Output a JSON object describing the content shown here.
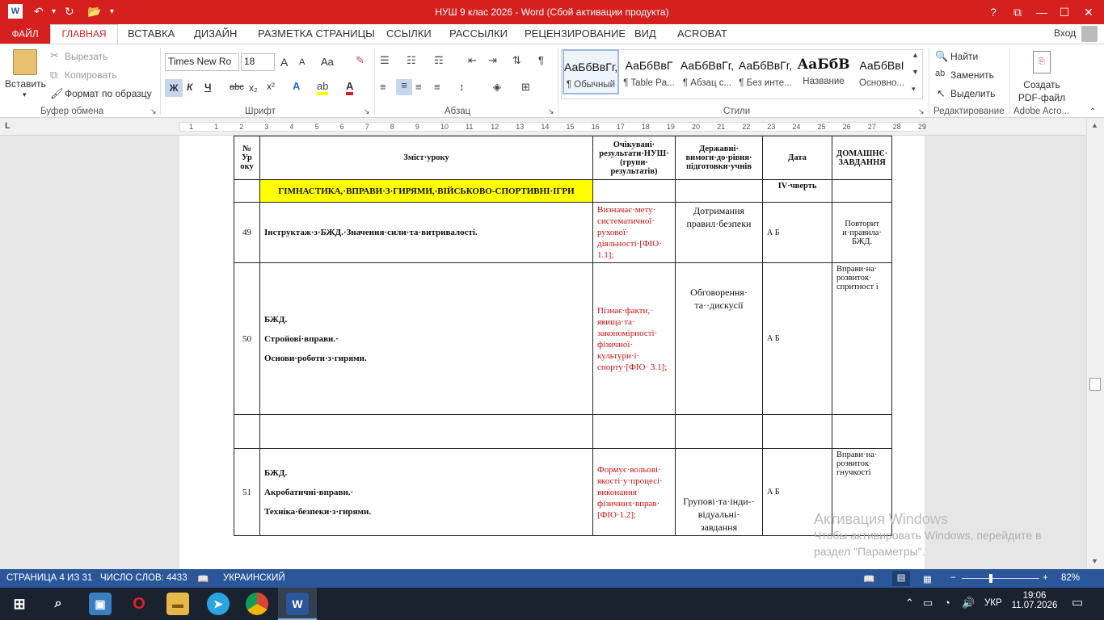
{
  "window": {
    "title": "НУШ 9 клас 2026 -  Word (Сбой активации продукта)",
    "help": "?",
    "min": "—",
    "max": "☐",
    "close": "✕"
  },
  "tabs": [
    "ФАЙЛ",
    "ГЛАВНАЯ",
    "ВСТАВКА",
    "ДИЗАЙН",
    "РАЗМЕТКА СТРАНИЦЫ",
    "ССЫЛКИ",
    "РАССЫЛКИ",
    "РЕЦЕНЗИРОВАНИЕ",
    "ВИД",
    "ACROBAT"
  ],
  "signin": "Вход",
  "ribbon": {
    "clipboard": {
      "paste": "Вставить",
      "cut": "Вырезать",
      "copy": "Копировать",
      "format_painter": "Формат по образцу",
      "label": "Буфер обмена"
    },
    "font": {
      "name": "Times New Ro",
      "size": "18",
      "label": "Шрифт",
      "bold": "Ж",
      "italic": "К",
      "underline": "Ч",
      "strike": "abc",
      "sub": "x₂",
      "sup": "x²",
      "grow": "A",
      "shrink": "A",
      "case": "Aa",
      "color": "A"
    },
    "paragraph": {
      "label": "Абзац"
    },
    "styles": {
      "label": "Стили",
      "items": [
        {
          "sample": "АаБбВвГг,",
          "name": "¶ Обычный"
        },
        {
          "sample": "АаБбВвГ",
          "name": "¶ Table Pa..."
        },
        {
          "sample": "АаБбВвГг,",
          "name": "¶ Абзац с..."
        },
        {
          "sample": "АаБбВвГг,",
          "name": "¶ Без инте..."
        },
        {
          "sample": "АаБбВ",
          "name": "Название"
        },
        {
          "sample": "АаБбВвІ",
          "name": "Основно..."
        }
      ]
    },
    "editing": {
      "find": "Найти",
      "replace": "Заменить",
      "select": "Выделить",
      "label": "Редактирование"
    },
    "acrobat": {
      "create": "Создать PDF-файл",
      "label": "Adobe Acro..."
    }
  },
  "ruler": {
    "marks": [
      "1",
      "1",
      "2",
      "3",
      "4",
      "5",
      "6",
      "7",
      "8",
      "9",
      "10",
      "11",
      "12",
      "13",
      "14",
      "15",
      "16",
      "17",
      "18",
      "19",
      "20",
      "21",
      "22",
      "23",
      "24",
      "25",
      "26",
      "27",
      "28",
      "29"
    ]
  },
  "table": {
    "headers": [
      "№ Ур оку",
      "Зміст·уроку",
      "Очікувані· результати·НУШ· (групи· результатів)",
      "Державні· вимоги·до·рівня· підготовки·учнів",
      "Дата",
      "ДОМАШНЄ· ЗАВДАННЯ"
    ],
    "section": "ГІМНАСТИКА,·ВПРАВИ·З·ГИРЯМИ,·ВІЙСЬКОВО-СПОРТИВНІ·ІГРИ",
    "quarter": "IV·чверть",
    "rows": [
      {
        "num": "49",
        "content": [
          "Інструктаж·з·БЖД.·Значення·сили·та·витривалості."
        ],
        "result": "Визначає·мету· систематичної· рухової· діяльності·[ФІО· 1.1];",
        "req": "Дотримання правил·безпеки",
        "date": "А Б",
        "hw": "Повторит и·правила· БЖД."
      },
      {
        "num": "50",
        "content": [
          "БЖД.",
          "Стройові·вправи.·",
          "Основи·роботи·з·гирями."
        ],
        "result": "Пізнає·факти,· явища·та· закономірності· фізичної· культури·і· спорту·[ФІО· 3.1];",
        "req": "Обговорення· та··дискусії",
        "date": "А Б",
        "hw": "Вправи·на· розвиток· спритност і"
      },
      {
        "num": "51",
        "content": [
          "БЖД.",
          "Акробатичні·вправи.·",
          "Техніка·безпеки·з·гирями."
        ],
        "result": "Формує·вольові· якості·у·процесі· виконання· фізичних·вправ· [ФІО·1.2];",
        "req": "Групові·та·інди-· відуальні· завдання",
        "date": "А Б",
        "hw": "Вправи·на· розвиток· гнучкості"
      }
    ]
  },
  "watermark": {
    "title": "Активация Windows",
    "line1": "Чтобы активировать Windows, перейдите в",
    "line2": "раздел \"Параметры\"."
  },
  "status": {
    "page": "СТРАНИЦА 4 ИЗ 31",
    "words": "ЧИСЛО СЛОВ: 4433",
    "lang": "УКРАИНСКИЙ",
    "zoom": "82%"
  },
  "taskbar": {
    "lang": "УКР",
    "time": "19:06",
    "date": "11.07.2026"
  },
  "colors": {
    "accent": "#d61f1f",
    "status": "#2b579a",
    "taskbar": "#1a2230"
  }
}
